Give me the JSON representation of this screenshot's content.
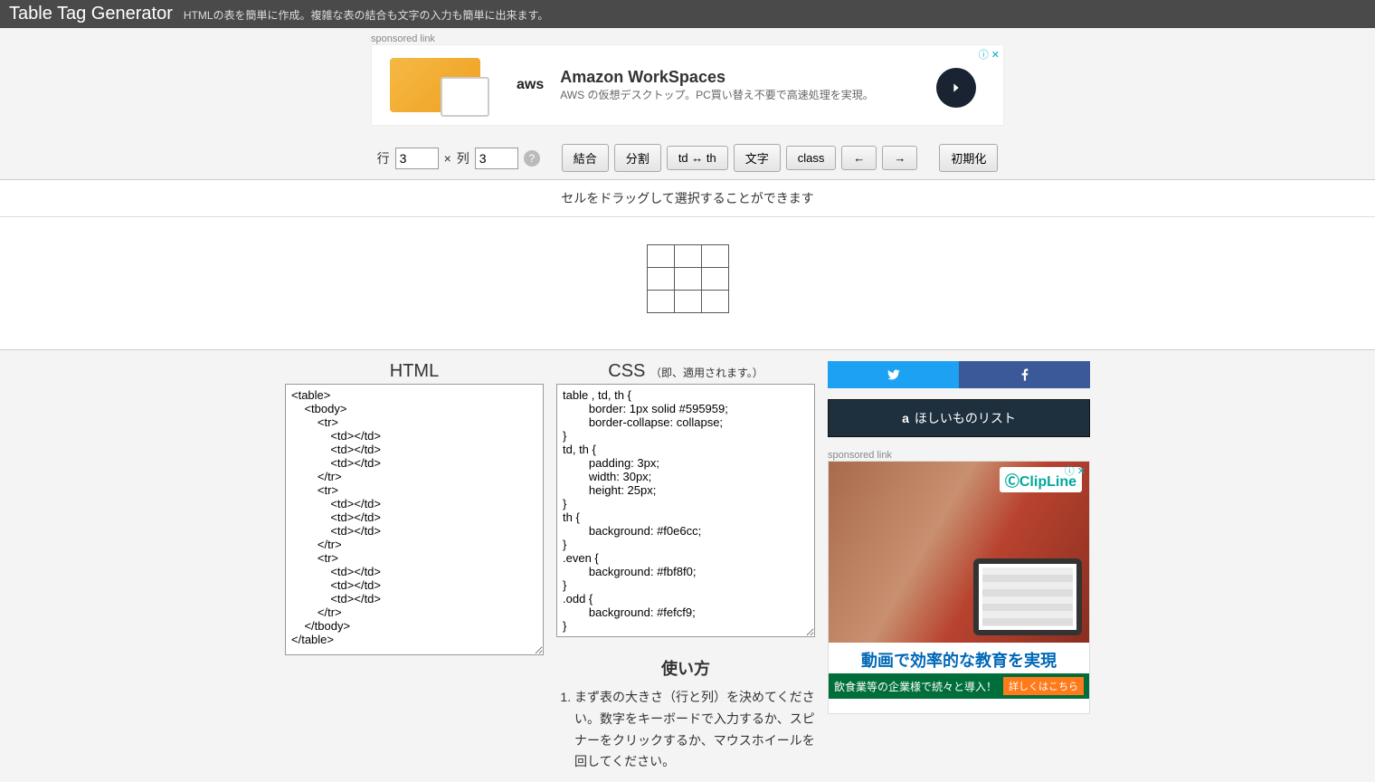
{
  "header": {
    "title": "Table Tag Generator",
    "subtitle": "HTMLの表を簡単に作成。複雑な表の結合も文字の入力も簡単に出来ます。"
  },
  "sponsored_label": "sponsored link",
  "ad_top": {
    "brand": "aws",
    "title": "Amazon WorkSpaces",
    "text": "AWS の仮想デスクトップ。PC買い替え不要で高速処理を実現。",
    "badge": "ⓘ ✕"
  },
  "toolbar": {
    "row_label": "行",
    "row_value": "3",
    "times": "×",
    "col_label": "列",
    "col_value": "3",
    "help": "?",
    "merge": "結合",
    "split": "分割",
    "tdth": "td ↔ th",
    "text": "文字",
    "class": "class",
    "undo": "←",
    "redo": "→",
    "reset": "初期化"
  },
  "hint": "セルをドラッグして選択することができます",
  "sections": {
    "html_title": "HTML",
    "css_title": "CSS",
    "css_sub": "（即、適用されます。）"
  },
  "code": {
    "html": "<table>\n    <tbody>\n        <tr>\n            <td></td>\n            <td></td>\n            <td></td>\n        </tr>\n        <tr>\n            <td></td>\n            <td></td>\n            <td></td>\n        </tr>\n        <tr>\n            <td></td>\n            <td></td>\n            <td></td>\n        </tr>\n    </tbody>\n</table>",
    "css": "table , td, th {\n\tborder: 1px solid #595959;\n\tborder-collapse: collapse;\n}\ntd, th {\n\tpadding: 3px;\n\twidth: 30px;\n\theight: 25px;\n}\nth {\n\tbackground: #f0e6cc;\n}\n.even {\n\tbackground: #fbf8f0;\n}\n.odd {\n\tbackground: #fefcf9;\n}"
  },
  "wishlist": "ほしいものリスト",
  "ad_side": {
    "brand": "ⒸClipLine",
    "headline": "動画で効率的な教育を実現",
    "sub": "飲食業等の企業様で続々と導入！",
    "cta": "詳しくはこちら",
    "badge": "ⓘ ✕"
  },
  "usage": {
    "title": "使い方",
    "items": [
      "まず表の大きさ（行と列）を決めてください。数字をキーボードで入力するか、スピナーをクリックするか、マウスホイールを回してください。"
    ]
  }
}
